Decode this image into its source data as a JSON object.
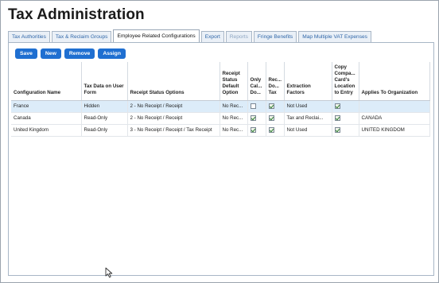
{
  "page": {
    "title": "Tax Administration"
  },
  "tabs": [
    {
      "label": "Tax Authorities",
      "state": "normal"
    },
    {
      "label": "Tax & Reclaim Groups",
      "state": "normal"
    },
    {
      "label": "Employee Related Configurations",
      "state": "active"
    },
    {
      "label": "Export",
      "state": "normal"
    },
    {
      "label": "Reports",
      "state": "disabled"
    },
    {
      "label": "Fringe Benefits",
      "state": "normal"
    },
    {
      "label": "Map Multiple VAT Expenses",
      "state": "normal"
    }
  ],
  "toolbar": {
    "save_label": "Save",
    "new_label": "New",
    "remove_label": "Remove",
    "assign_label": "Assign"
  },
  "table": {
    "columns": {
      "config_name": "Configuration Name",
      "tax_data": "Tax Data on User Form",
      "receipt_status": "Receipt Status Options",
      "receipt_default": "Receipt Status Default Option",
      "only_calc": "Only Cal... Do...",
      "rec_do_tax": "Rec... Do... Tax",
      "extraction": "Extraction Factors",
      "copy_company": "Copy Compa... Card's Location to Entry",
      "applies_to": "Applies To Organization"
    },
    "rows": [
      {
        "config_name": "France",
        "tax_data": "Hidden",
        "receipt_status": "2 - No Receipt / Receipt",
        "receipt_default": "No Rec...",
        "only_calc": false,
        "rec_do_tax": true,
        "extraction": "Not Used",
        "copy_company": true,
        "applies_to": ""
      },
      {
        "config_name": "Canada",
        "tax_data": "Read-Only",
        "receipt_status": "2 - No Receipt / Receipt",
        "receipt_default": "No Rec...",
        "only_calc": true,
        "rec_do_tax": true,
        "extraction": "Tax and Reclai...",
        "copy_company": true,
        "applies_to": "CANADA"
      },
      {
        "config_name": "United Kingdom",
        "tax_data": "Read-Only",
        "receipt_status": "3 - No Receipt / Receipt / Tax Receipt",
        "receipt_default": "No Rec...",
        "only_calc": true,
        "rec_do_tax": true,
        "extraction": "Not Used",
        "copy_company": true,
        "applies_to": "UNITED KINGDOM"
      }
    ]
  },
  "colors": {
    "accent": "#1f6fd1",
    "selected_row": "#dcecf9",
    "tab_link": "#2f66a8"
  },
  "icons": {
    "checkbox": "checkbox-icon",
    "cursor": "mouse-pointer-icon"
  }
}
